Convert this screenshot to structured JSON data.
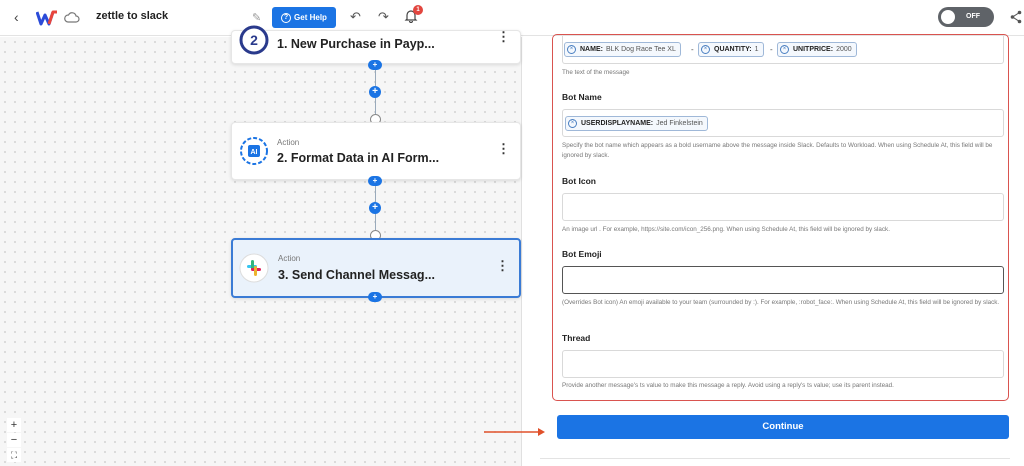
{
  "header": {
    "title": "zettle to slack",
    "help_label": "Get Help",
    "notification_count": "1",
    "toggle_label": "OFF"
  },
  "workflow": {
    "nodes": [
      {
        "kind": "",
        "name": "1. New Purchase in Payp..."
      },
      {
        "kind": "Action",
        "name": "2. Format Data in AI Form..."
      },
      {
        "kind": "Action",
        "name": "3. Send Channel Messag..."
      }
    ]
  },
  "zoom": {
    "in": "+",
    "out": "−",
    "fit": "⛶"
  },
  "form": {
    "message_chips": [
      {
        "key": "NAME:",
        "value": "BLK Dog Race Tee XL"
      },
      {
        "key": "QUANTITY:",
        "value": "1"
      },
      {
        "key": "UNITPRICE:",
        "value": "2000"
      }
    ],
    "chip_separator": "-",
    "message_help": "The text of the message",
    "bot_name_label": "Bot Name",
    "bot_name_chip": {
      "key": "USERDISPLAYNAME:",
      "value": "Jed Finkelstein"
    },
    "bot_name_help": "Specify the bot name which appears as a bold username above the message inside Slack. Defaults to Workload. When using Schedule At, this field will be ignored by slack.",
    "bot_icon_label": "Bot Icon",
    "bot_icon_value": "",
    "bot_icon_help": "An image url . For example, https://site.com/icon_256.png. When using Schedule At, this field will be ignored by slack.",
    "bot_emoji_label": "Bot Emoji",
    "bot_emoji_value": "",
    "bot_emoji_help": "(Overrides Bot icon) An emoji available to your team (surrounded by :). For example, :robot_face:. When using Schedule At, this field will be ignored by slack.",
    "thread_label": "Thread",
    "thread_value": "",
    "thread_help": "Provide another message's ts value to make this message a reply. Avoid using a reply's ts value; use its parent instead.",
    "continue_label": "Continue"
  },
  "colors": {
    "accent": "#1b74e4",
    "highlight_border": "#d9534f",
    "arrow": "#e0502a"
  }
}
